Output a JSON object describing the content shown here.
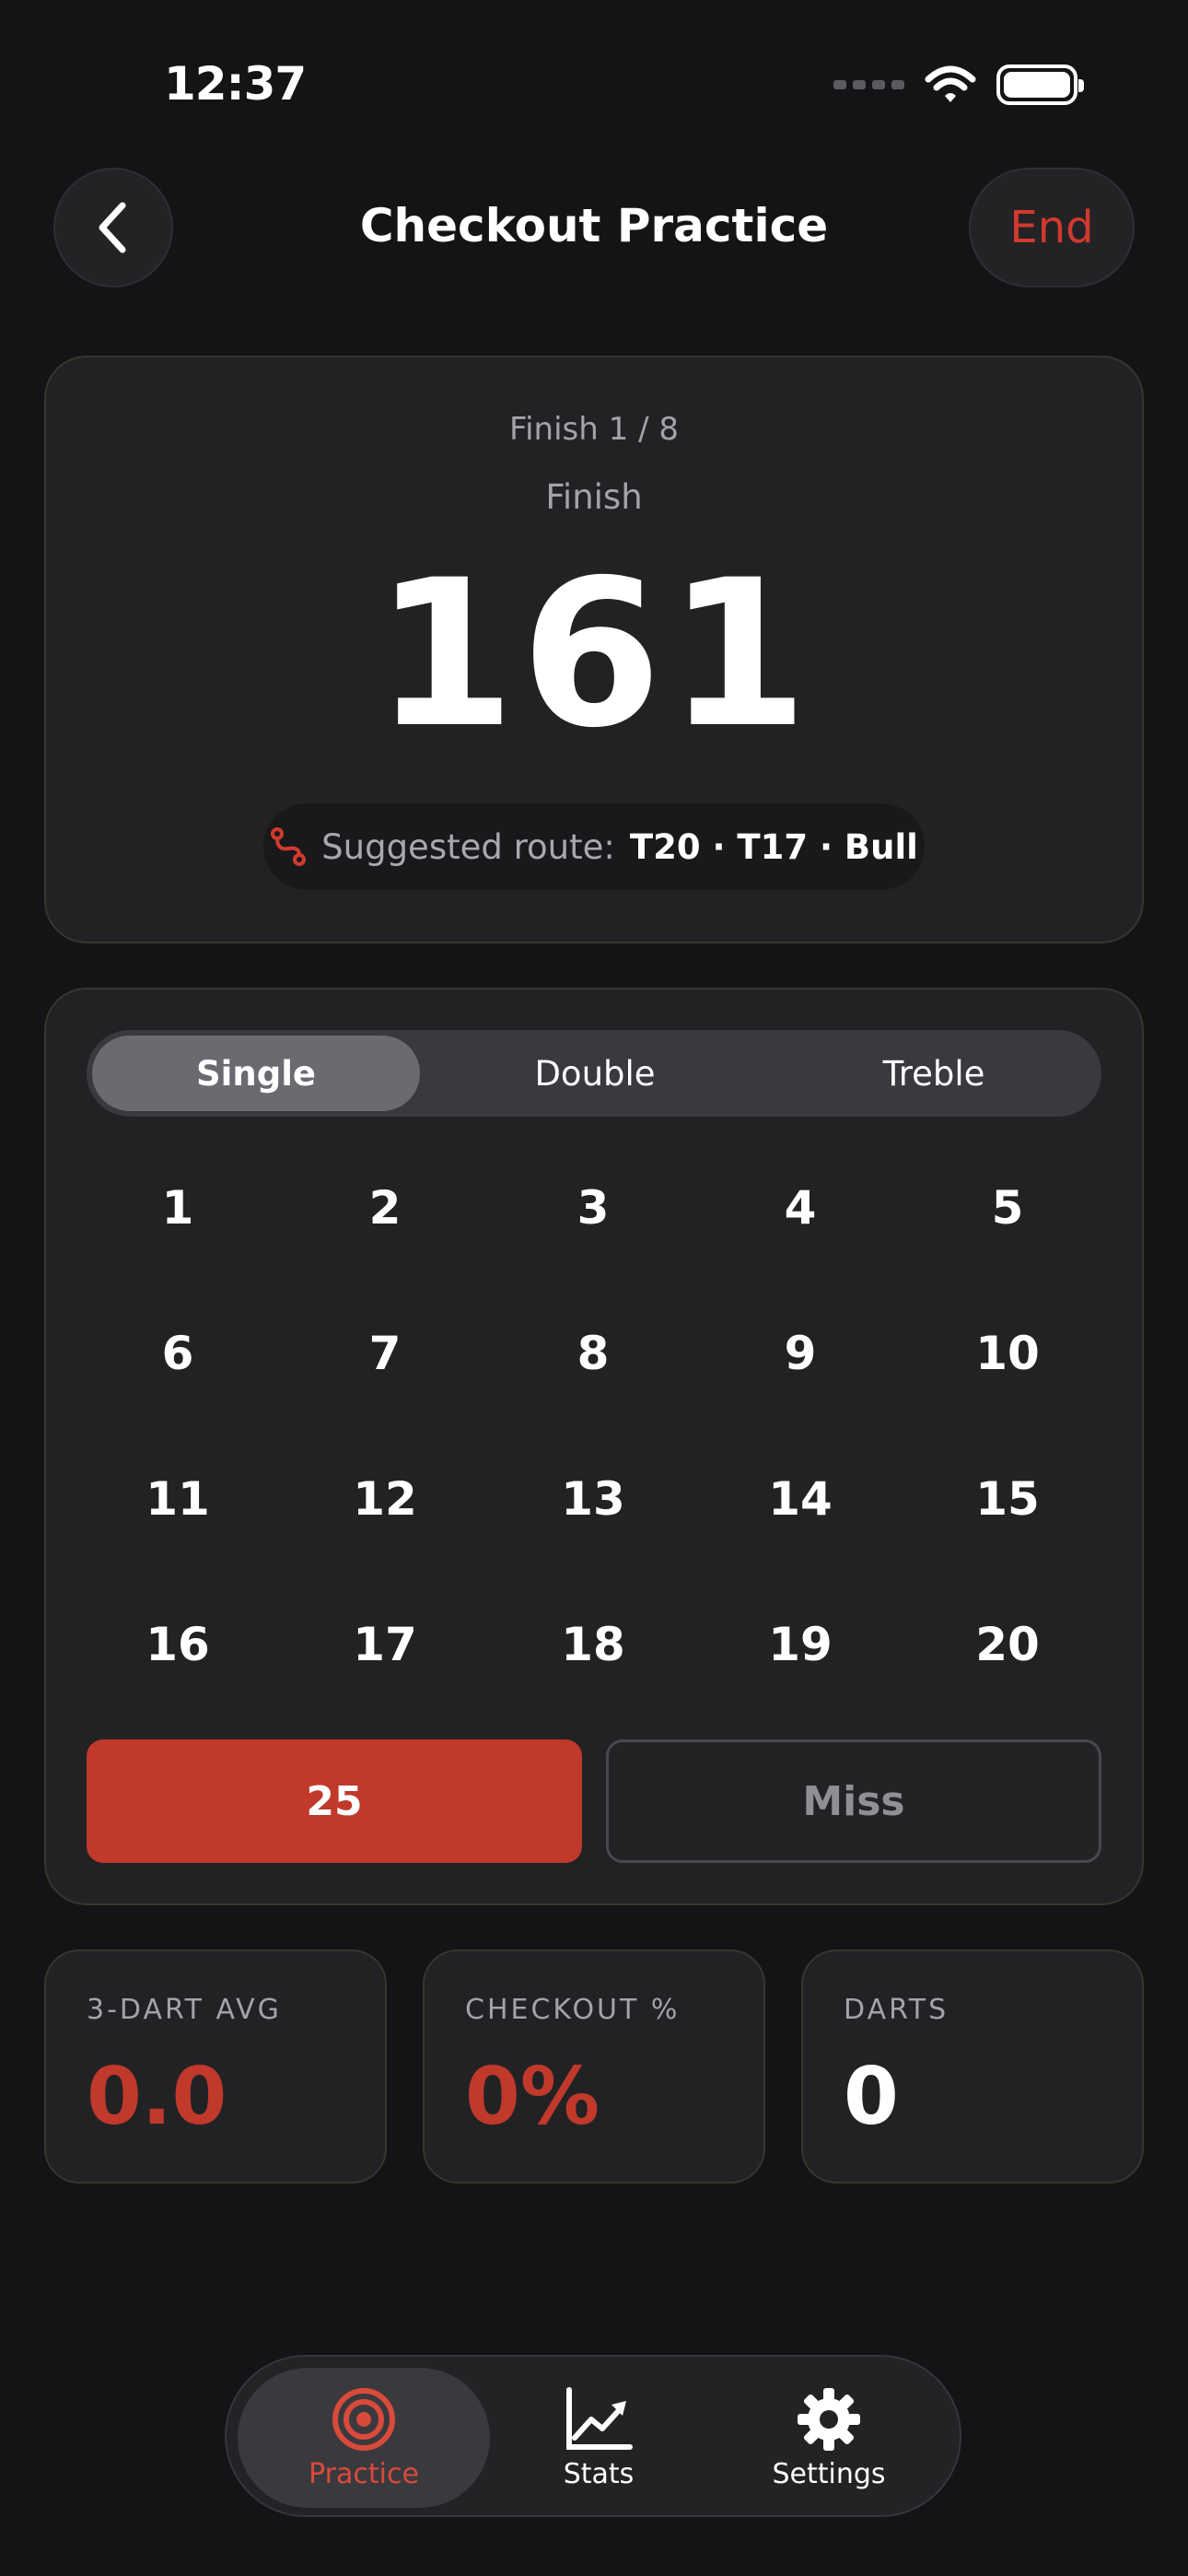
{
  "status_bar": {
    "time": "12:37"
  },
  "header": {
    "title": "Checkout Practice",
    "end_label": "End"
  },
  "finish_card": {
    "progress": "Finish 1 / 8",
    "label": "Finish",
    "score": "161",
    "route_prefix": "Suggested route:",
    "route": "T20 · T17 · Bull"
  },
  "segments": [
    {
      "label": "Single",
      "active": true
    },
    {
      "label": "Double",
      "active": false
    },
    {
      "label": "Treble",
      "active": false
    }
  ],
  "numbers": [
    "1",
    "2",
    "3",
    "4",
    "5",
    "6",
    "7",
    "8",
    "9",
    "10",
    "11",
    "12",
    "13",
    "14",
    "15",
    "16",
    "17",
    "18",
    "19",
    "20"
  ],
  "actions": {
    "bull_label": "25",
    "miss_label": "Miss"
  },
  "stats": [
    {
      "label": "3-DART AVG",
      "value": "0.0"
    },
    {
      "label": "CHECKOUT %",
      "value": "0%"
    },
    {
      "label": "DARTS",
      "value": "0"
    }
  ],
  "tabs": [
    {
      "label": "Practice",
      "icon": "target-icon",
      "active": true
    },
    {
      "label": "Stats",
      "icon": "chart-icon",
      "active": false
    },
    {
      "label": "Settings",
      "icon": "gear-icon",
      "active": false
    }
  ],
  "colors": {
    "accent": "#c0392b",
    "background": "#141416",
    "card": "#222225"
  }
}
